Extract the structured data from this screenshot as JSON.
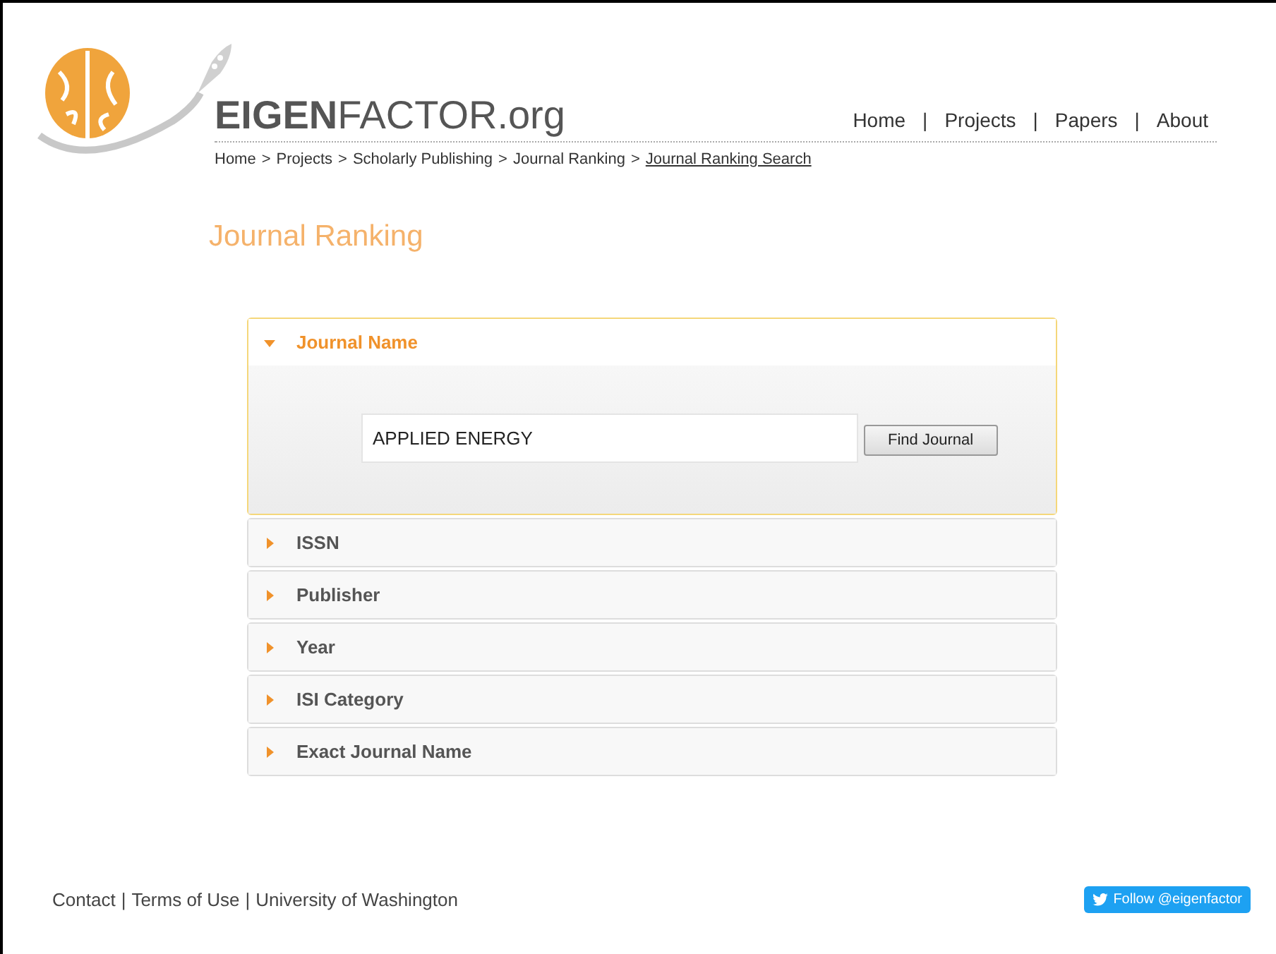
{
  "logo": {
    "text": "**EIGEN**FACTOR.org"
  },
  "nav": {
    "separator": "|",
    "items": [
      {
        "label": "Home"
      },
      {
        "label": "Projects"
      },
      {
        "label": "Papers"
      },
      {
        "label": "About"
      }
    ]
  },
  "breadcrumb": {
    "separator": ">",
    "items": [
      {
        "label": "Home",
        "current": false
      },
      {
        "label": "Projects",
        "current": false
      },
      {
        "label": "Scholarly Publishing",
        "current": false
      },
      {
        "label": "Journal Ranking",
        "current": false
      },
      {
        "label": "Journal Ranking Search",
        "current": true
      }
    ]
  },
  "page_title": "Journal Ranking",
  "accordion": [
    {
      "label": "Journal Name",
      "expanded": true,
      "field_value": "APPLIED ENERGY",
      "button": "Find Journal"
    },
    {
      "label": "ISSN",
      "expanded": false
    },
    {
      "label": "Publisher",
      "expanded": false
    },
    {
      "label": "Year",
      "expanded": false
    },
    {
      "label": "ISI Category",
      "expanded": false
    },
    {
      "label": "Exact Journal Name",
      "expanded": false
    }
  ],
  "footer": {
    "separator": "|",
    "links": [
      "Contact",
      "Terms of Use",
      "University of Washington"
    ],
    "follow_button": "Follow @eigenfactor"
  }
}
